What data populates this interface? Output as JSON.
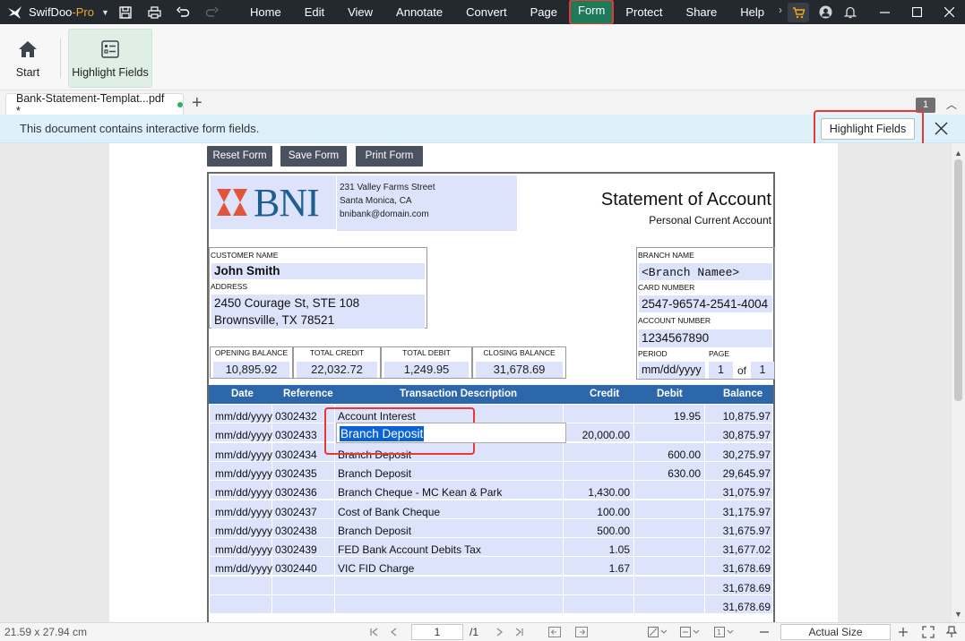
{
  "app": {
    "name": "SwifDoo",
    "name_suffix": "-Pro"
  },
  "menu": [
    "Home",
    "Edit",
    "View",
    "Annotate",
    "Convert",
    "Page",
    "Form",
    "Protect",
    "Share",
    "Help"
  ],
  "ribbon": {
    "start_label": "Start",
    "highlight_label": "Highlight Fields"
  },
  "tab": {
    "title": "Bank-Statement-Templat...pdf *",
    "page_badge": "1"
  },
  "notice": {
    "message": "This document contains interactive form fields.",
    "button": "Highlight Fields"
  },
  "form_buttons": {
    "reset": "Reset Form",
    "save": "Save Form",
    "print": "Print Form"
  },
  "statement": {
    "bank": "BNI",
    "address": [
      "231 Valley Farms Street",
      "Santa Monica, CA",
      "bnibank@domain.com"
    ],
    "title": "Statement of Account",
    "subtitle": "Personal Current Account",
    "customer_label": "CUSTOMER NAME",
    "customer": "John Smith",
    "address_label": "ADDRESS",
    "address_line1": "2450 Courage St, STE 108",
    "address_line2": "Brownsville, TX 78521",
    "branch_label": "BRANCH NAME",
    "branch": "<Branch Namee>",
    "card_label": "CARD NUMBER",
    "card": "2547-96574-2541-4004",
    "account_label": "ACCOUNT NUMBER",
    "account": "1234567890",
    "period_label": "PERIOD",
    "period": "mm/dd/yyyy",
    "page_label": "PAGE",
    "page_num": "1",
    "page_of": "of",
    "page_total": "1",
    "summary": [
      {
        "label": "OPENING BALANCE",
        "value": "10,895.92"
      },
      {
        "label": "TOTAL CREDIT",
        "value": "22,032.72"
      },
      {
        "label": "TOTAL DEBIT",
        "value": "1,249.95"
      },
      {
        "label": "CLOSING BALANCE",
        "value": "31,678.69"
      }
    ],
    "columns": [
      "Date",
      "Reference",
      "Transaction Description",
      "Credit",
      "Debit",
      "Balance"
    ],
    "rows": [
      {
        "date": "mm/dd/yyyy",
        "ref": "0302432",
        "desc": "Account Interest",
        "credit": "",
        "debit": "19.95",
        "balance": "10,875.97"
      },
      {
        "date": "mm/dd/yyyy",
        "ref": "0302433",
        "desc": "Branch Deposit",
        "credit": "20,000.00",
        "debit": "",
        "balance": "30,875.97"
      },
      {
        "date": "mm/dd/yyyy",
        "ref": "0302434",
        "desc": "Branch Deposit",
        "credit": "",
        "debit": "600.00",
        "balance": "30,275.97"
      },
      {
        "date": "mm/dd/yyyy",
        "ref": "0302435",
        "desc": "Branch Deposit",
        "credit": "",
        "debit": "630.00",
        "balance": "29,645.97"
      },
      {
        "date": "mm/dd/yyyy",
        "ref": "0302436",
        "desc": "Branch Cheque - MC Kean & Park",
        "credit": "1,430.00",
        "debit": "",
        "balance": "31,075.97"
      },
      {
        "date": "mm/dd/yyyy",
        "ref": "0302437",
        "desc": "Cost of Bank Cheque",
        "credit": "100.00",
        "debit": "",
        "balance": "31,175.97"
      },
      {
        "date": "mm/dd/yyyy",
        "ref": "0302438",
        "desc": "Branch Deposit",
        "credit": "500.00",
        "debit": "",
        "balance": "31,675.97"
      },
      {
        "date": "mm/dd/yyyy",
        "ref": "0302439",
        "desc": "FED Bank Account Debits Tax",
        "credit": "1.05",
        "debit": "",
        "balance": "31,677.02"
      },
      {
        "date": "mm/dd/yyyy",
        "ref": "0302440",
        "desc": "VIC FID Charge",
        "credit": "1.67",
        "debit": "",
        "balance": "31,678.69"
      },
      {
        "date": "",
        "ref": "",
        "desc": "",
        "credit": "",
        "debit": "",
        "balance": "31,678.69"
      },
      {
        "date": "",
        "ref": "",
        "desc": "",
        "credit": "",
        "debit": "",
        "balance": "31,678.69"
      }
    ],
    "active_field_value": "Branch Deposit"
  },
  "status": {
    "dimensions": "21.59 x 27.94 cm",
    "page_input": "1",
    "page_total": "/1",
    "zoom": "Actual Size"
  }
}
